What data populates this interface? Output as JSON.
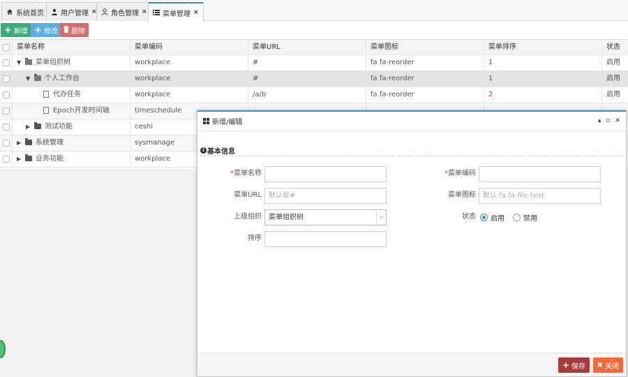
{
  "tabs": [
    {
      "label": "系统首页",
      "icon": "home-icon",
      "closable": false,
      "active": false
    },
    {
      "label": "用户管理",
      "icon": "user-icon",
      "closable": true,
      "active": false
    },
    {
      "label": "角色管理",
      "icon": "user-outline-icon",
      "closable": true,
      "active": false
    },
    {
      "label": "菜单管理",
      "icon": "list-icon",
      "closable": true,
      "active": true
    }
  ],
  "toolbar": {
    "add_label": "新增",
    "edit_label": "修改",
    "delete_label": "删除"
  },
  "table": {
    "columns": [
      "菜单名称",
      "菜单编码",
      "菜单URL",
      "菜单图标",
      "菜单排序",
      "状态"
    ],
    "rows": [
      {
        "name": "菜单组织树",
        "code": "workplace",
        "url": "#",
        "icon": "fa fa-reorder",
        "order": "1",
        "status": "启用",
        "depth": 0,
        "toggle": "▼",
        "kind": "folder-open"
      },
      {
        "name": "个人工作台",
        "code": "workplace",
        "url": "#",
        "icon": "fa fa-reorder",
        "order": "1",
        "status": "启用",
        "depth": 1,
        "toggle": "▼",
        "kind": "folder-open"
      },
      {
        "name": "代办任务",
        "code": "workplace",
        "url": "/a/b",
        "icon": "fa fa-reorder",
        "order": "2",
        "status": "启用",
        "depth": 2,
        "toggle": "",
        "kind": "file"
      },
      {
        "name": "Epoch开发时间轴",
        "code": "timeschedule",
        "url": "",
        "icon": "",
        "order": "",
        "status": "",
        "depth": 2,
        "toggle": "",
        "kind": "file"
      },
      {
        "name": "测试功能",
        "code": "ceshi",
        "url": "",
        "icon": "",
        "order": "",
        "status": "",
        "depth": 1,
        "toggle": "▶",
        "kind": "folder"
      },
      {
        "name": "系统管理",
        "code": "sysmanage",
        "url": "",
        "icon": "",
        "order": "",
        "status": "",
        "depth": 0,
        "toggle": "▶",
        "kind": "folder"
      },
      {
        "name": "业务功能",
        "code": "workplace",
        "url": "",
        "icon": "",
        "order": "",
        "status": "",
        "depth": 0,
        "toggle": "▶",
        "kind": "folder"
      }
    ]
  },
  "dialog": {
    "title": "新增/编辑",
    "section": "基本信息",
    "fields": {
      "menu_name": {
        "label": "菜单名称",
        "required": true,
        "value": "",
        "placeholder": ""
      },
      "menu_code": {
        "label": "菜单编码",
        "required": true,
        "value": "",
        "placeholder": ""
      },
      "menu_url": {
        "label": "菜单URL",
        "value": "",
        "placeholder": "默认是#"
      },
      "menu_icon": {
        "label": "菜单图标",
        "value": "",
        "placeholder": "默认:fa fa-file-text"
      },
      "parent": {
        "label": "上级组织",
        "value": "菜单组织树"
      },
      "status": {
        "label": "状态",
        "options": [
          "启用",
          "禁用"
        ],
        "selected": "启用"
      },
      "order": {
        "label": "排序",
        "value": "",
        "placeholder": ""
      }
    },
    "required_mark": "*",
    "save_label": "保存",
    "close_label": "关闭"
  }
}
